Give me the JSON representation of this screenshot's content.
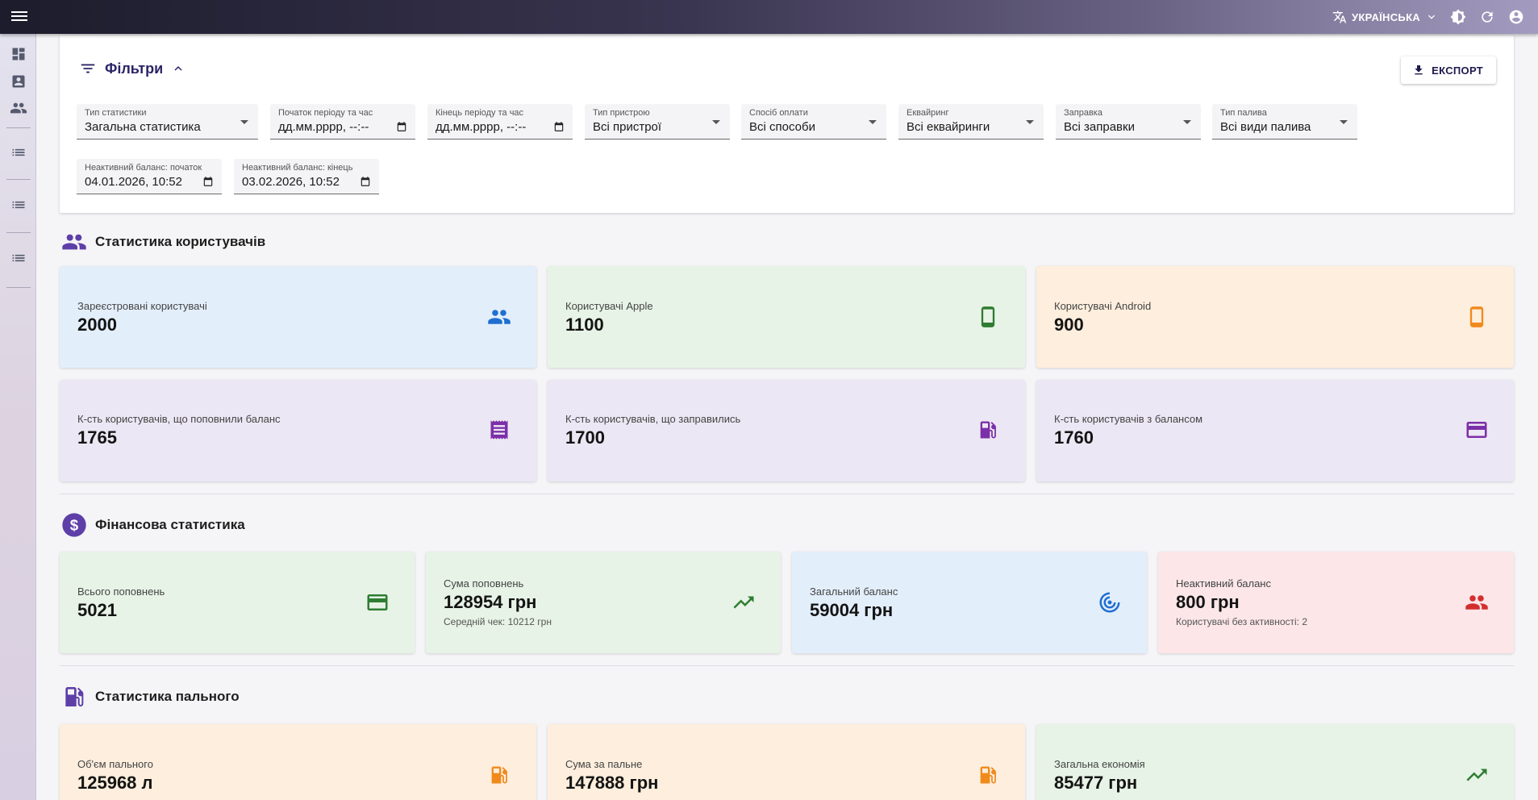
{
  "topbar": {
    "language": "УКРАЇНСЬКА",
    "icons": [
      "menu-icon",
      "translate-icon",
      "chevron-down-icon",
      "theme-icon",
      "refresh-icon",
      "account-icon"
    ]
  },
  "sidebar": {
    "icons": [
      "dashboard-icon",
      "contact-icon",
      "users-icon",
      "list-icon",
      "list-icon",
      "list-icon"
    ]
  },
  "filters": {
    "title": "Фільтри",
    "export_label": "ЕКСПОРТ",
    "fields": [
      {
        "label": "Тип статистики",
        "value": "Загальна статистика"
      },
      {
        "label": "Початок періоду та час",
        "value": "дд.мм.рррр, --:--"
      },
      {
        "label": "Кінець періоду та час",
        "value": "дд.мм.рррр, --:--"
      },
      {
        "label": "Тип пристрою",
        "value": "Всі пристрої"
      },
      {
        "label": "Спосіб оплати",
        "value": "Всі способи"
      },
      {
        "label": "Еквайринг",
        "value": "Всі еквайринги"
      },
      {
        "label": "Заправка",
        "value": "Всі заправки"
      },
      {
        "label": "Тип палива",
        "value": "Всі види палива"
      },
      {
        "label": "Неактивний баланс: початок",
        "value": "04.01.2026, 10:52"
      },
      {
        "label": "Неактивний баланс: кінець",
        "value": "03.02.2026, 10:52"
      }
    ]
  },
  "users_section": {
    "title": "Статистика користувачів",
    "cards": [
      {
        "label": "Зареєстровані користувачі",
        "value": "2000",
        "icon": "users-icon",
        "color": "#1f6fd1"
      },
      {
        "label": "Користувачі Apple",
        "value": "1100",
        "icon": "phone-icon",
        "color": "#2e7d32"
      },
      {
        "label": "Користувачі Android",
        "value": "900",
        "icon": "phone-icon",
        "color": "#f08a1c"
      },
      {
        "label": "К-сть користувачів, що поповнили баланс",
        "value": "1765",
        "icon": "receipt-icon",
        "color": "#7b2fa8"
      },
      {
        "label": "К-сть користувачів, що заправились",
        "value": "1700",
        "icon": "fuel-icon",
        "color": "#7b2fa8"
      },
      {
        "label": "К-сть користувачів з балансом",
        "value": "1760",
        "icon": "card-icon",
        "color": "#7b2fa8"
      }
    ]
  },
  "finance_section": {
    "title": "Фінансова статистика",
    "cards": [
      {
        "label": "Всього поповнень",
        "value": "5021",
        "sub": "",
        "icon": "card-icon",
        "color": "#2e7d32"
      },
      {
        "label": "Сума поповнень",
        "value": "128954 грн",
        "sub": "Середній чек: 10212 грн",
        "icon": "trending-up-icon",
        "color": "#2e7d32"
      },
      {
        "label": "Загальний баланс",
        "value": "59004 грн",
        "sub": "",
        "icon": "target-icon",
        "color": "#1f6fd1"
      },
      {
        "label": "Неактивний баланс",
        "value": "800 грн",
        "sub": "Користувачі без активності: 2",
        "icon": "users-icon",
        "color": "#d32f2f"
      }
    ]
  },
  "fuel_section": {
    "title": "Статистика пального",
    "cards": [
      {
        "label": "Об'єм пального",
        "value": "125968 л",
        "icon": "fuel-icon",
        "color": "#f08a1c"
      },
      {
        "label": "Сума за пальне",
        "value": "147888 грн",
        "icon": "fuel-icon",
        "color": "#f08a1c"
      },
      {
        "label": "Загальна економія",
        "value": "85477 грн",
        "icon": "trending-up-icon",
        "color": "#2e7d32"
      }
    ]
  }
}
